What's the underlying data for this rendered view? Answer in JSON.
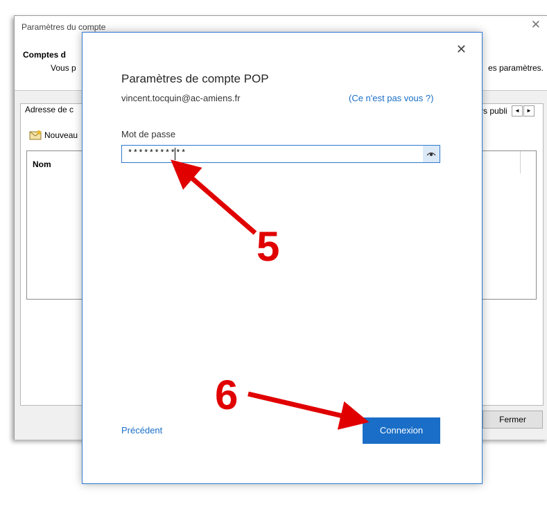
{
  "background_dialog": {
    "title": "Paramètres du compte",
    "heading": "Comptes d",
    "subtitle_left": "Vous p",
    "subtitle_right": "es paramètres.",
    "tab_left": "Adresse de c",
    "tab_right": "rs publi",
    "scroll_left": "◄",
    "scroll_right": "►",
    "new_button": "Nouveau",
    "list_column": "Nom",
    "close_button": "Fermer"
  },
  "dialog": {
    "title": "Paramètres de compte POP",
    "email": "vincent.tocquin@ac-amiens.fr",
    "not_you": "(Ce n'est pas vous ?)",
    "password_label": "Mot de passe",
    "password_value": "***********",
    "back_link": "Précédent",
    "connect_button": "Connexion"
  },
  "annotations": {
    "step_5": "5",
    "step_6": "6"
  },
  "colors": {
    "accent": "#1a6ec7",
    "annotation": "#e00000"
  }
}
